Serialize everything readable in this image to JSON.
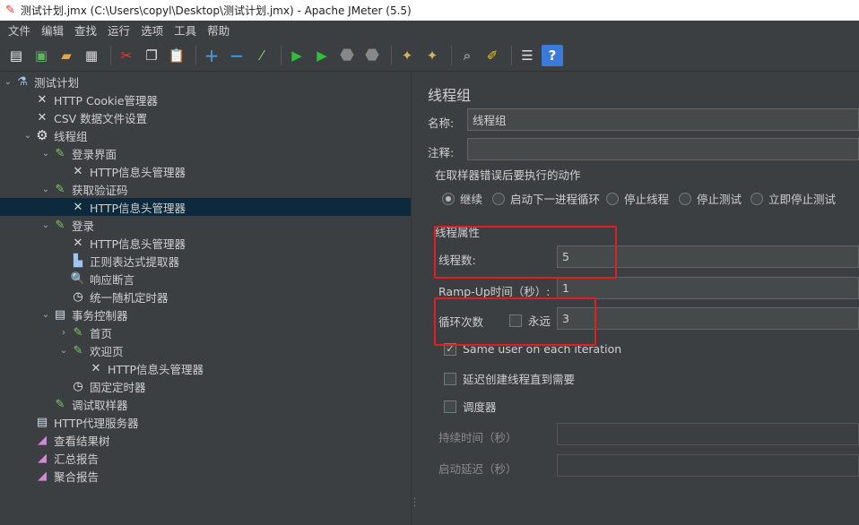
{
  "window": {
    "title": "测试计划.jmx (C:\\Users\\copyl\\Desktop\\测试计划.jmx) - Apache JMeter (5.5)"
  },
  "menu": [
    "文件",
    "编辑",
    "查找",
    "运行",
    "选项",
    "工具",
    "帮助"
  ],
  "tree": {
    "nodes": [
      {
        "label": "测试计划",
        "icon": "flask-icon"
      },
      {
        "label": "HTTP Cookie管理器",
        "icon": "wrench-icon"
      },
      {
        "label": "CSV 数据文件设置",
        "icon": "wrench-icon"
      },
      {
        "label": "线程组",
        "icon": "gear-icon"
      },
      {
        "label": "登录界面",
        "icon": "sampler-icon"
      },
      {
        "label": "HTTP信息头管理器",
        "icon": "wrench-icon"
      },
      {
        "label": "获取验证码",
        "icon": "sampler-icon"
      },
      {
        "label": "HTTP信息头管理器",
        "icon": "wrench-icon"
      },
      {
        "label": "登录",
        "icon": "sampler-icon"
      },
      {
        "label": "HTTP信息头管理器",
        "icon": "wrench-icon"
      },
      {
        "label": "正则表达式提取器",
        "icon": "extractor-icon"
      },
      {
        "label": "响应断言",
        "icon": "magnifier-icon"
      },
      {
        "label": "统一随机定时器",
        "icon": "clock-icon"
      },
      {
        "label": "事务控制器",
        "icon": "controller-icon"
      },
      {
        "label": "首页",
        "icon": "sampler-icon"
      },
      {
        "label": "欢迎页",
        "icon": "sampler-icon"
      },
      {
        "label": "HTTP信息头管理器",
        "icon": "wrench-icon"
      },
      {
        "label": "固定定时器",
        "icon": "clock-icon"
      },
      {
        "label": "调试取样器",
        "icon": "sampler-icon"
      },
      {
        "label": "HTTP代理服务器",
        "icon": "proxy-icon"
      },
      {
        "label": "查看结果树",
        "icon": "chart-icon"
      },
      {
        "label": "汇总报告",
        "icon": "chart-icon"
      },
      {
        "label": "聚合报告",
        "icon": "chart-icon"
      }
    ]
  },
  "panel": {
    "title": "线程组",
    "name_label": "名称:",
    "name_value": "线程组",
    "comment_label": "注释:",
    "comment_value": "",
    "error_action_title": "在取样器错误后要执行的动作",
    "error_actions": [
      "继续",
      "启动下一进程循环",
      "停止线程",
      "停止测试",
      "立即停止测试"
    ],
    "thread_props_title": "线程属性",
    "threads_label": "线程数:",
    "threads_value": "5",
    "rampup_label": "Ramp-Up时间（秒）:",
    "rampup_value": "1",
    "loop_label": "循环次数",
    "forever_label": "永远",
    "loop_value": "3",
    "same_user_label": "Same user on each iteration",
    "delay_label": "延迟创建线程直到需要",
    "scheduler_label": "调度器",
    "duration_label": "持续时间（秒）",
    "startup_delay_label": "启动延迟（秒）"
  },
  "colors": {
    "accent_red": "#e02020",
    "selection": "#0d293e",
    "background": "#3c3f41"
  }
}
